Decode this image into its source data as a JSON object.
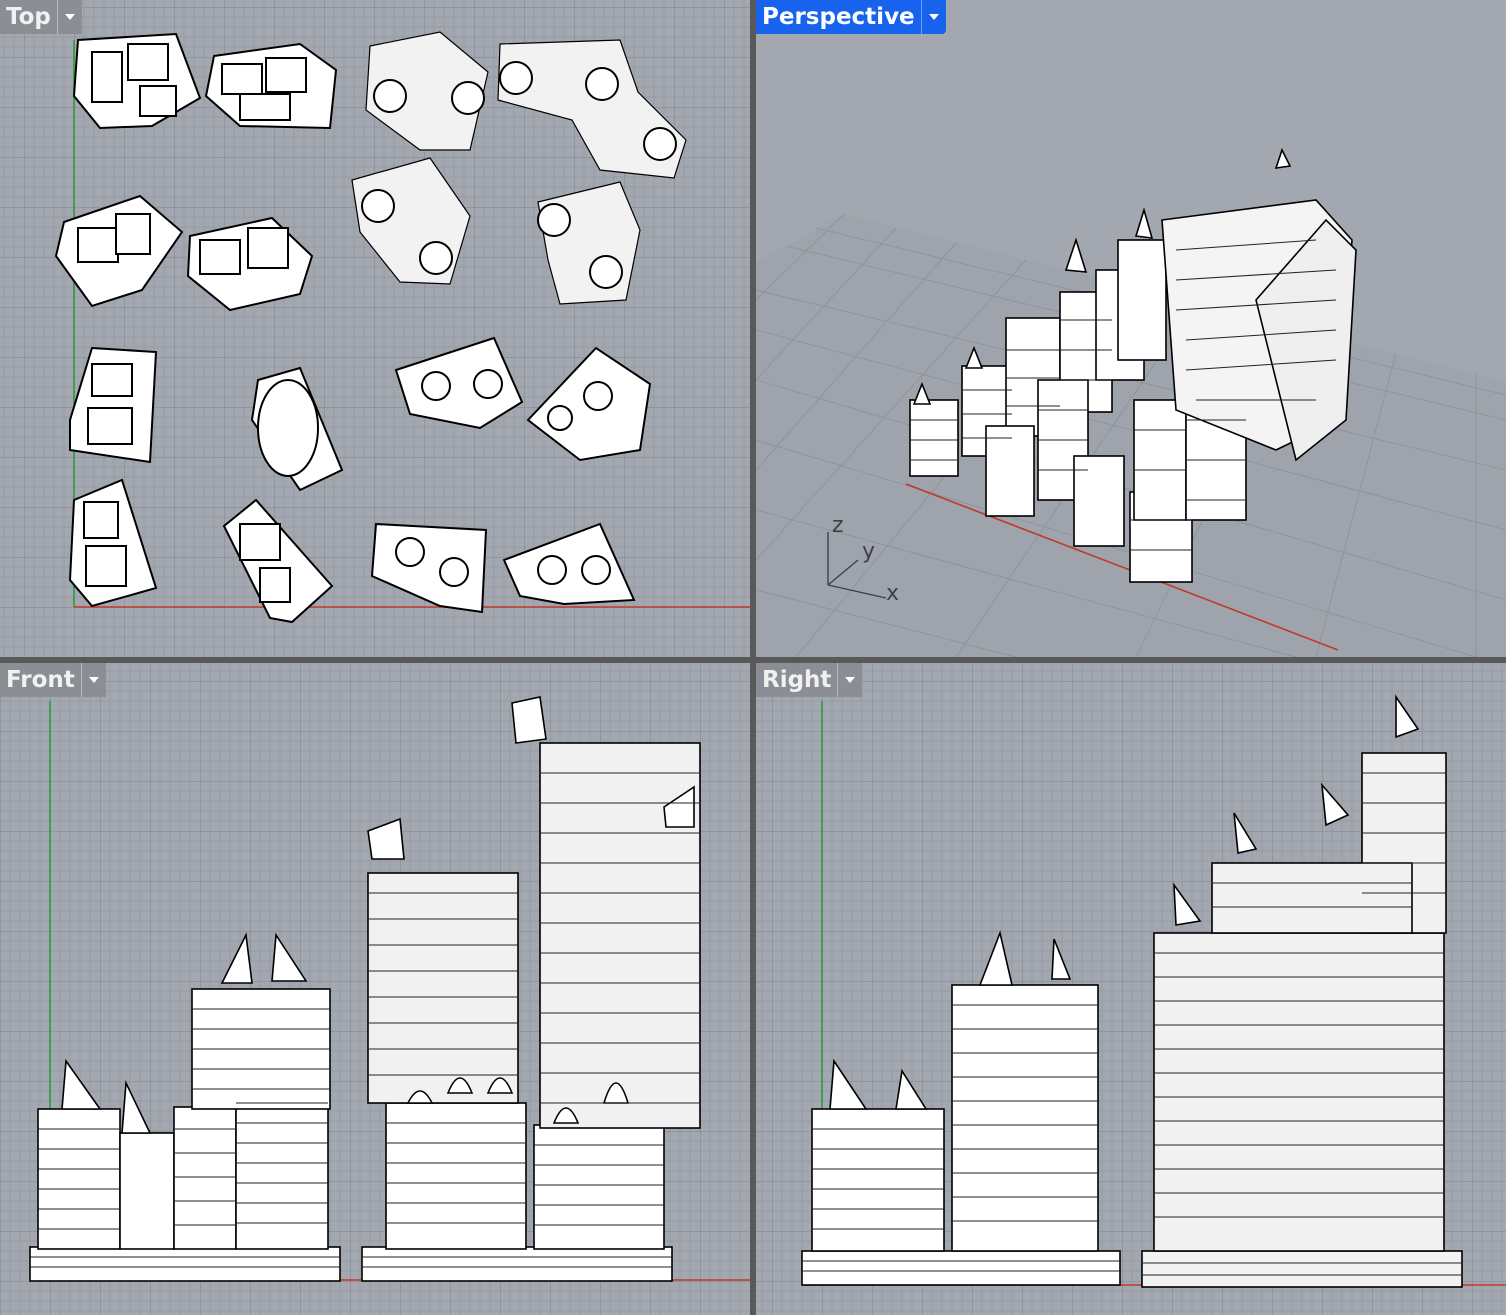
{
  "viewports": {
    "top": {
      "label": "Top",
      "active": false
    },
    "perspective": {
      "label": "Perspective",
      "active": true,
      "axes": {
        "z": "z",
        "y": "y",
        "x": "x"
      }
    },
    "front": {
      "label": "Front",
      "active": false
    },
    "right": {
      "label": "Right",
      "active": false
    }
  },
  "colors": {
    "viewport_bg": "#a3a8b0",
    "grid_minor": "#979ca4",
    "grid_major": "#868b93",
    "active_tab": "#1763ee",
    "inactive_tab": "#8b8e94",
    "x_axis": "#c0392b",
    "y_axis": "#2e9a3c",
    "frame": "#595959"
  },
  "icons": {
    "dropdown": "chevron-down-icon"
  }
}
